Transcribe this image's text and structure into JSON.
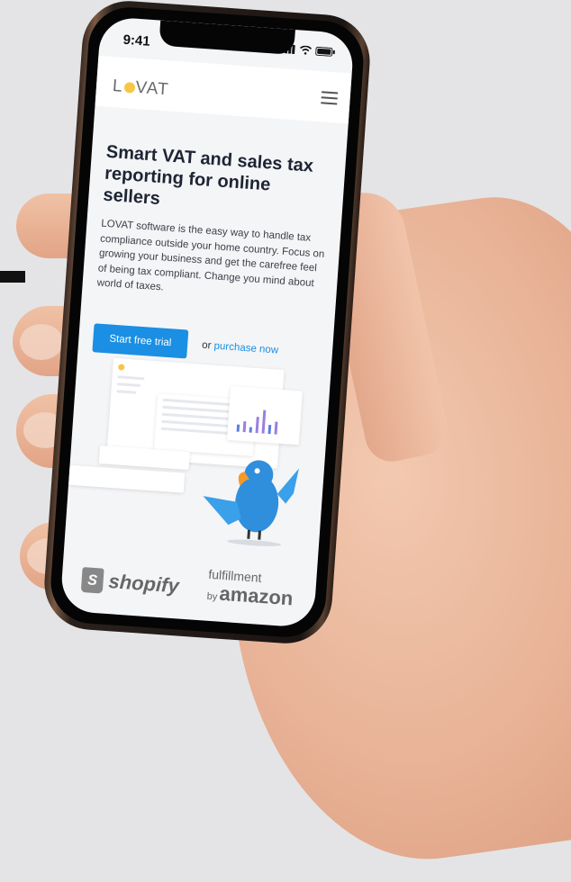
{
  "status": {
    "time": "9:41"
  },
  "nav": {
    "logo": "LOVAT"
  },
  "hero": {
    "title": "Smart VAT and sales tax reporting for online sellers",
    "description": "LOVAT software is the easy way to handle tax compliance outside your home country. Focus on growing your business and get the carefree feel of being tax compliant. Change you mind about world of taxes.",
    "cta_label": "Start free trial",
    "or_text": "or",
    "purchase_link": "purchase now"
  },
  "partners": {
    "shopify": "shopify",
    "fba_line1": "fulfillment",
    "fba_by": "by",
    "fba_amazon": "amazon"
  },
  "colors": {
    "accent": "#1a8fe3",
    "logo_dot": "#f6c744"
  }
}
